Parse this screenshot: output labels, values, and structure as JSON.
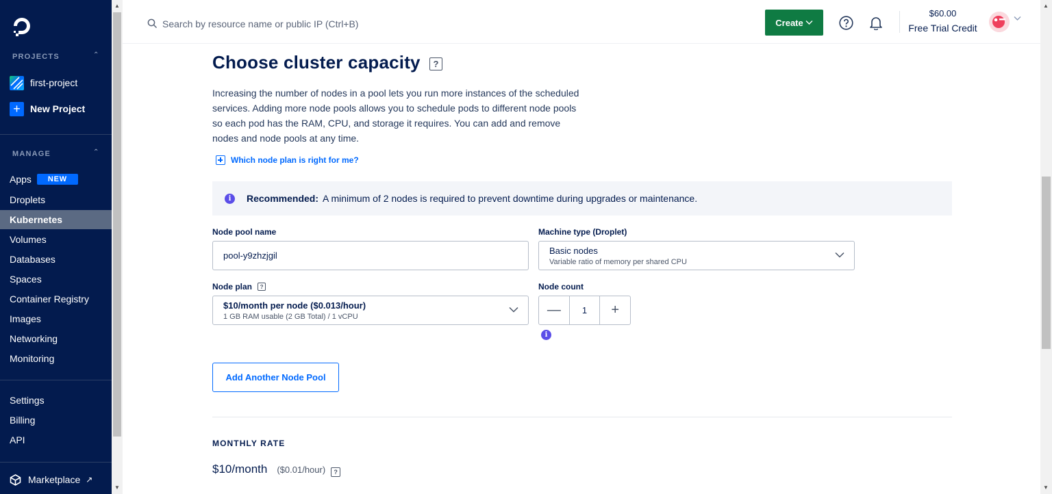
{
  "sidebar": {
    "projects_heading": "PROJECTS",
    "projects": [
      {
        "label": "first-project",
        "icon": "project-stripes-icon"
      },
      {
        "label": "New Project",
        "icon": "plus-icon"
      }
    ],
    "manage_heading": "MANAGE",
    "manage_items": [
      {
        "label": "Apps",
        "badge": "NEW"
      },
      {
        "label": "Droplets"
      },
      {
        "label": "Kubernetes",
        "active": true
      },
      {
        "label": "Volumes"
      },
      {
        "label": "Databases"
      },
      {
        "label": "Spaces"
      },
      {
        "label": "Container Registry"
      },
      {
        "label": "Images"
      },
      {
        "label": "Networking"
      },
      {
        "label": "Monitoring"
      }
    ],
    "account_items": [
      {
        "label": "Settings"
      },
      {
        "label": "Billing"
      },
      {
        "label": "API"
      }
    ],
    "marketplace": {
      "label": "Marketplace",
      "icon": "external-link-icon"
    }
  },
  "header": {
    "search_placeholder": "Search by resource name or public IP (Ctrl+B)",
    "create_label": "Create",
    "credit_amount": "$60.00",
    "credit_label": "Free Trial Credit"
  },
  "main": {
    "title": "Choose cluster capacity",
    "title_help": "?",
    "description": "Increasing the number of nodes in a pool lets you run more instances of the scheduled services. Adding more node pools allows you to schedule pods to different node pools so each pod has the RAM, CPU, and storage it requires. You can add and remove nodes and node pools at any time.",
    "which_plan_link": "Which node plan is right for me?",
    "recommended_label": "Recommended:",
    "recommended_text": "A minimum of 2 nodes is required to prevent downtime during upgrades or maintenance.",
    "node_pool_name_label": "Node pool name",
    "node_pool_name_value": "pool-y9zhzjgil",
    "machine_type_label": "Machine type (Droplet)",
    "machine_type_main": "Basic nodes",
    "machine_type_sub": "Variable ratio of memory per shared CPU",
    "node_plan_label": "Node plan",
    "node_plan_main": "$10/month per node ($0.013/hour)",
    "node_plan_sub": "1 GB RAM usable (2 GB Total) / 1 vCPU",
    "node_count_label": "Node count",
    "node_count_value": "1",
    "add_pool_label": "Add Another Node Pool",
    "monthly_rate_heading": "MONTHLY RATE",
    "monthly_rate": "$10/month",
    "hourly_rate": "($0.01/hour)"
  },
  "colors": {
    "sidebar_bg": "#031b4e",
    "accent_blue": "#0069ff",
    "create_green": "#0f7b43",
    "info_purple": "#5b4ee8"
  }
}
